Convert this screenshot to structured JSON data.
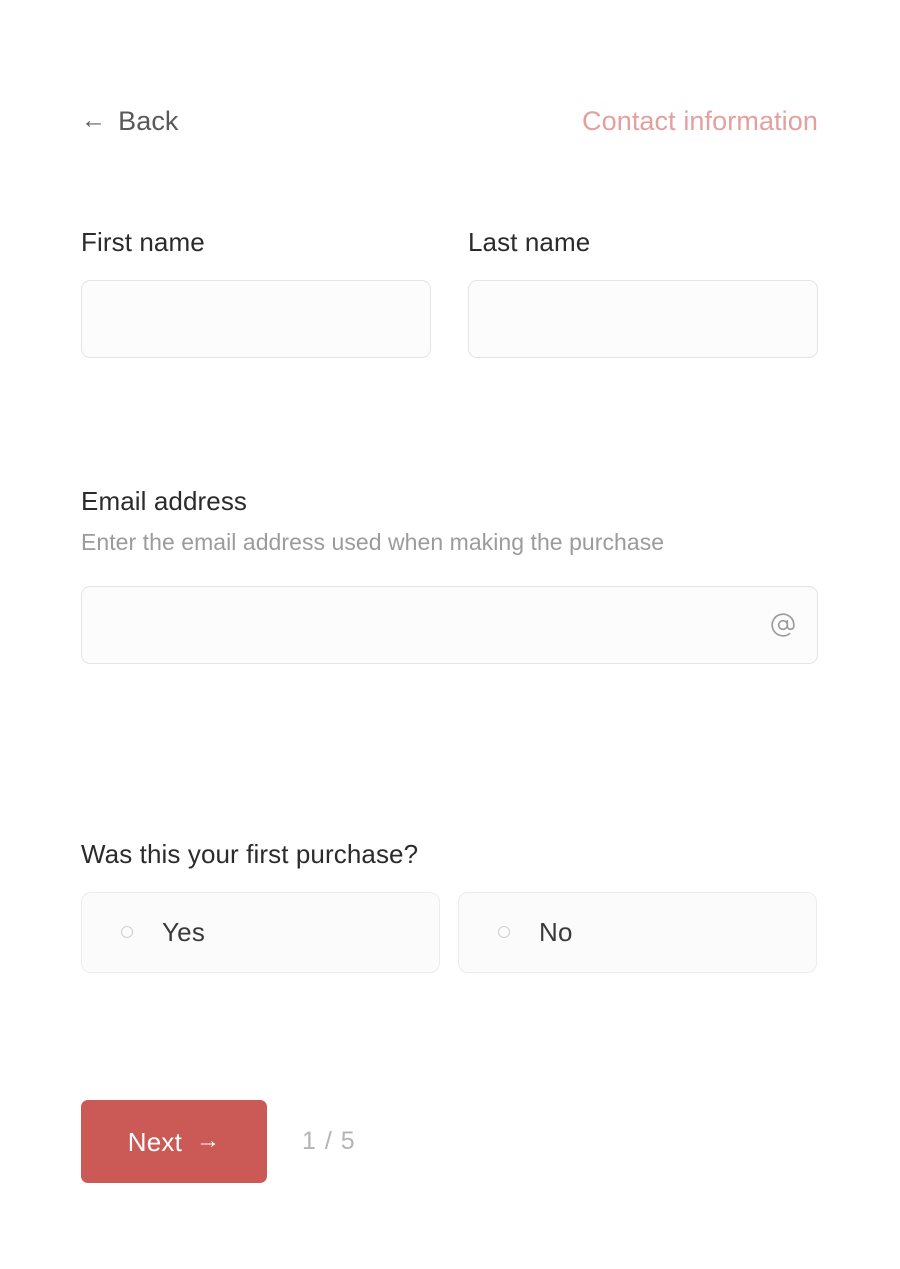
{
  "header": {
    "back_label": "Back",
    "back_arrow": "←",
    "section_title": "Contact information",
    "title_color": "#e3a09e"
  },
  "form": {
    "first_name": {
      "label": "First name",
      "value": "",
      "placeholder": ""
    },
    "last_name": {
      "label": "Last name",
      "value": "",
      "placeholder": ""
    },
    "email": {
      "label": "Email address",
      "help": "Enter the email address used when making the purchase",
      "value": "",
      "placeholder": "",
      "icon": "at-sign-icon"
    },
    "first_purchase_question": {
      "label": "Was this your first purchase?",
      "selected": null,
      "options": [
        {
          "label": "Yes",
          "value": "yes",
          "selected": false
        },
        {
          "label": "No",
          "value": "no",
          "selected": false
        }
      ]
    }
  },
  "footer": {
    "next_label": "Next",
    "next_arrow": "→",
    "next_color": "#cb5a57",
    "step_counter": "1 / 5",
    "current_step": 1,
    "total_steps": 5
  }
}
